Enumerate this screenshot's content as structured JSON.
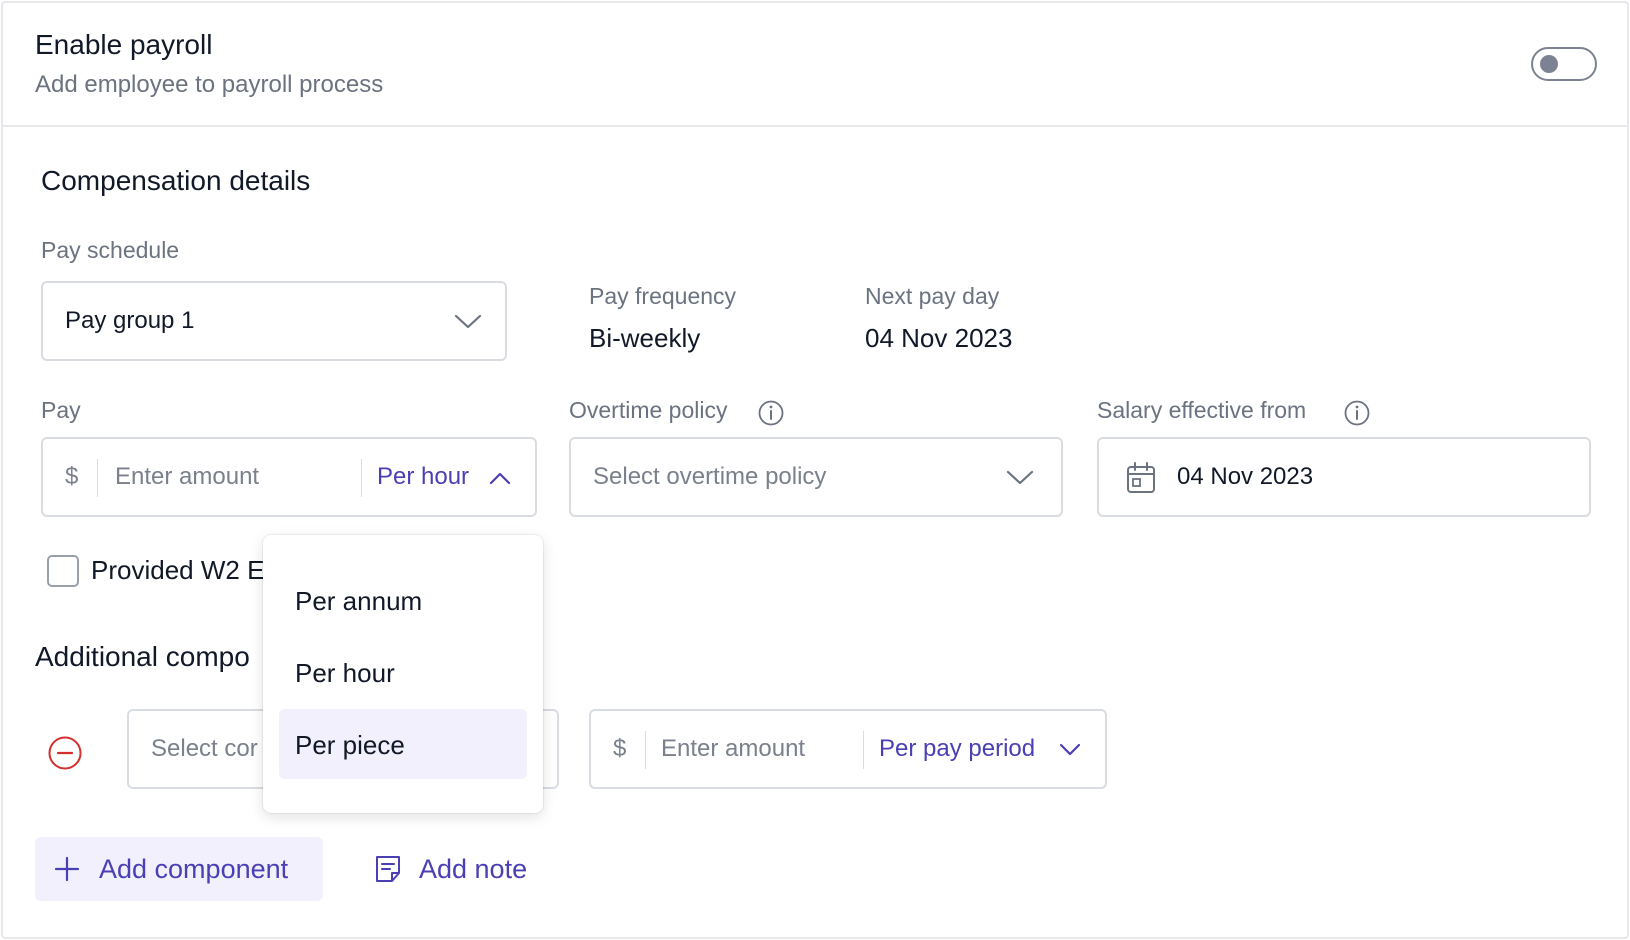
{
  "payroll": {
    "title": "Enable payroll",
    "subtitle": "Add employee to payroll process",
    "enabled": false
  },
  "compensation": {
    "section_title": "Compensation details",
    "pay_schedule": {
      "label": "Pay schedule",
      "value": "Pay group 1"
    },
    "pay_frequency": {
      "label": "Pay frequency",
      "value": "Bi-weekly"
    },
    "next_pay_day": {
      "label": "Next pay day",
      "value": "04 Nov 2023"
    },
    "pay": {
      "label": "Pay",
      "currency": "$",
      "placeholder": "Enter amount",
      "unit": "Per hour"
    },
    "overtime_policy": {
      "label": "Overtime policy",
      "placeholder": "Select overtime policy"
    },
    "salary_effective": {
      "label": "Salary effective from",
      "value": "04 Nov 2023"
    },
    "w2_checkbox": {
      "label": "Provided W2 E",
      "checked": false
    }
  },
  "pay_unit_dropdown": {
    "options": [
      "Per annum",
      "Per hour",
      "Per piece"
    ],
    "highlighted": "Per piece"
  },
  "additional": {
    "section_title": "Additional compo",
    "component_select_placeholder": "Select cor",
    "currency": "$",
    "amount_placeholder": "Enter amount",
    "period": "Per pay period",
    "add_component_label": "Add component",
    "add_note_label": "Add note"
  },
  "colors": {
    "accent": "#4b3fb5",
    "accent_bg": "#f1f0fc",
    "remove": "#d32f2f",
    "border": "#d9dce1"
  }
}
